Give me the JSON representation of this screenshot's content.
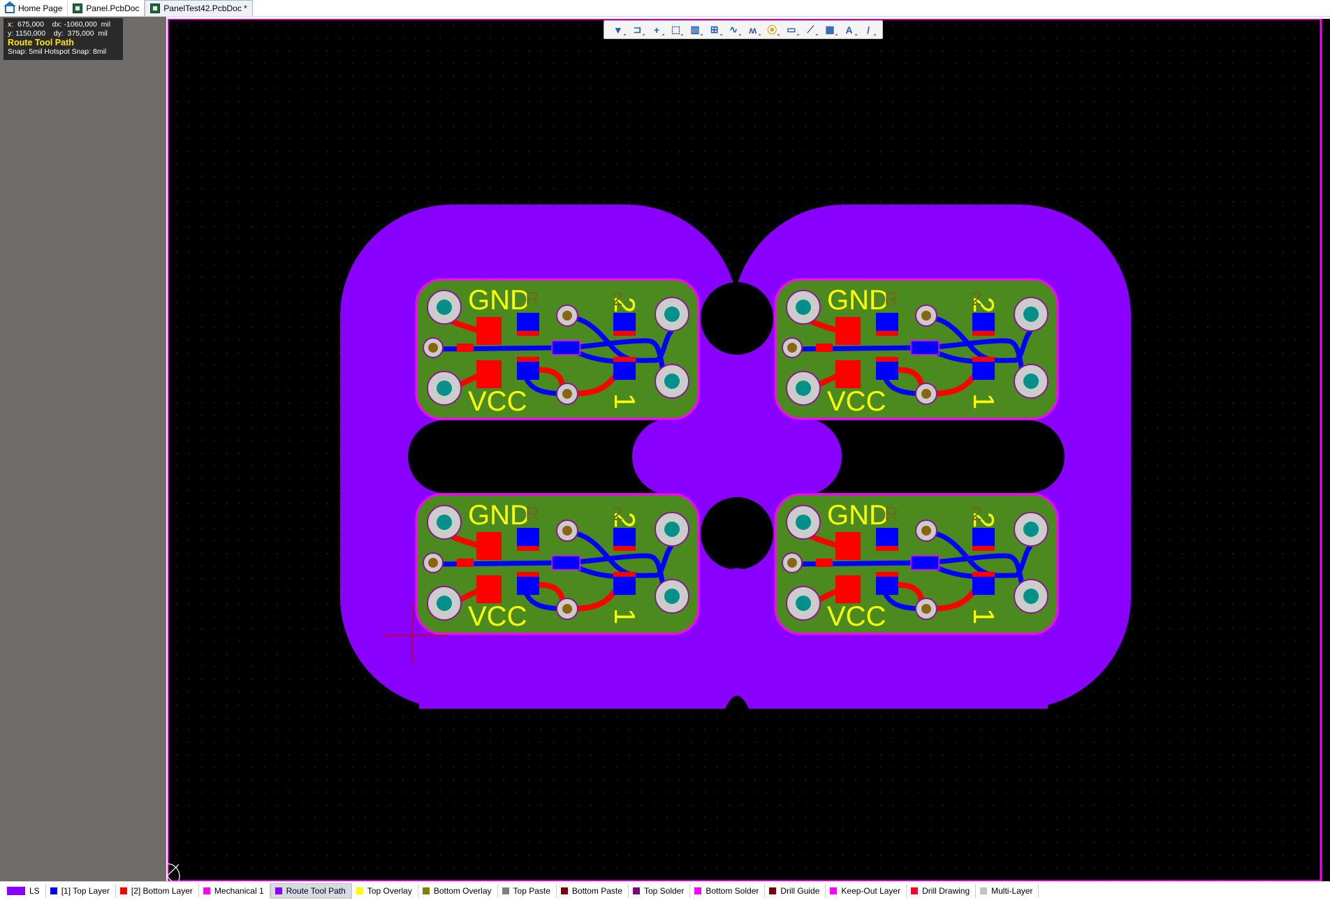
{
  "tabs": [
    {
      "label": "Home Page",
      "icon": "home-icon",
      "active": false
    },
    {
      "label": "Panel.PcbDoc",
      "icon": "pcb-document-icon",
      "active": false
    },
    {
      "label": "PanelTest42.PcbDoc *",
      "icon": "pcb-document-icon",
      "active": true
    }
  ],
  "hud": {
    "line1": "x:  675,000    dx: -1060,000  mil",
    "line2": "y: 1150,000    dy:  375,000  mil",
    "command": "Route Tool Path",
    "snap": "Snap: 5mil Hotspot Snap: 8mil"
  },
  "toolbar": {
    "tools": [
      "filter-icon",
      "interactive-connect-icon",
      "place-cursor-icon",
      "select-area-icon",
      "align-icon",
      "place-component-icon",
      "route-icon",
      "interactive-diff-pair-icon",
      "place-via-icon",
      "place-polygon-icon",
      "place-line-icon",
      "place-fill-icon",
      "place-string-icon",
      "place-track-icon"
    ],
    "labels": [
      "▼",
      "⊐",
      "+",
      "⬚",
      "▥",
      "⊞",
      "∿",
      "ʍ",
      "⦿",
      "▭",
      "⟋",
      "▦",
      "A",
      "/"
    ]
  },
  "board": {
    "silk_labels": {
      "gnd": "GND",
      "vcc": "VCC",
      "pin1": "1",
      "pin2": "2",
      "ref": "R"
    },
    "colors": {
      "background": "#000000",
      "route_tool_path": "#8a00ff",
      "board_fill": "#4a8a1f",
      "top_layer": "#ff0000",
      "bottom_layer": "#0000ff",
      "pad_ring": "#cccccc",
      "pad_hole": "#00908a",
      "overlay": "#ffff00",
      "keepout": "#ff00ff"
    }
  },
  "layers": [
    {
      "label": "LS",
      "color": "#8a00ff",
      "active": false
    },
    {
      "label": "[1] Top Layer",
      "color": "#0000ff",
      "active": false
    },
    {
      "label": "[2] Bottom Layer",
      "color": "#ff0000",
      "active": false
    },
    {
      "label": "Mechanical 1",
      "color": "#ff00ff",
      "active": false
    },
    {
      "label": "Route Tool Path",
      "color": "#8a00ff",
      "active": true
    },
    {
      "label": "Top Overlay",
      "color": "#ffff00",
      "active": false
    },
    {
      "label": "Bottom Overlay",
      "color": "#808000",
      "active": false
    },
    {
      "label": "Top Paste",
      "color": "#808080",
      "active": false
    },
    {
      "label": "Bottom Paste",
      "color": "#800000",
      "active": false
    },
    {
      "label": "Top Solder",
      "color": "#800080",
      "active": false
    },
    {
      "label": "Bottom Solder",
      "color": "#ff00ff",
      "active": false
    },
    {
      "label": "Drill Guide",
      "color": "#800000",
      "active": false
    },
    {
      "label": "Keep-Out Layer",
      "color": "#ff00ff",
      "active": false
    },
    {
      "label": "Drill Drawing",
      "color": "#ff002a",
      "active": false
    },
    {
      "label": "Multi-Layer",
      "color": "#c0c0c0",
      "active": false
    }
  ]
}
